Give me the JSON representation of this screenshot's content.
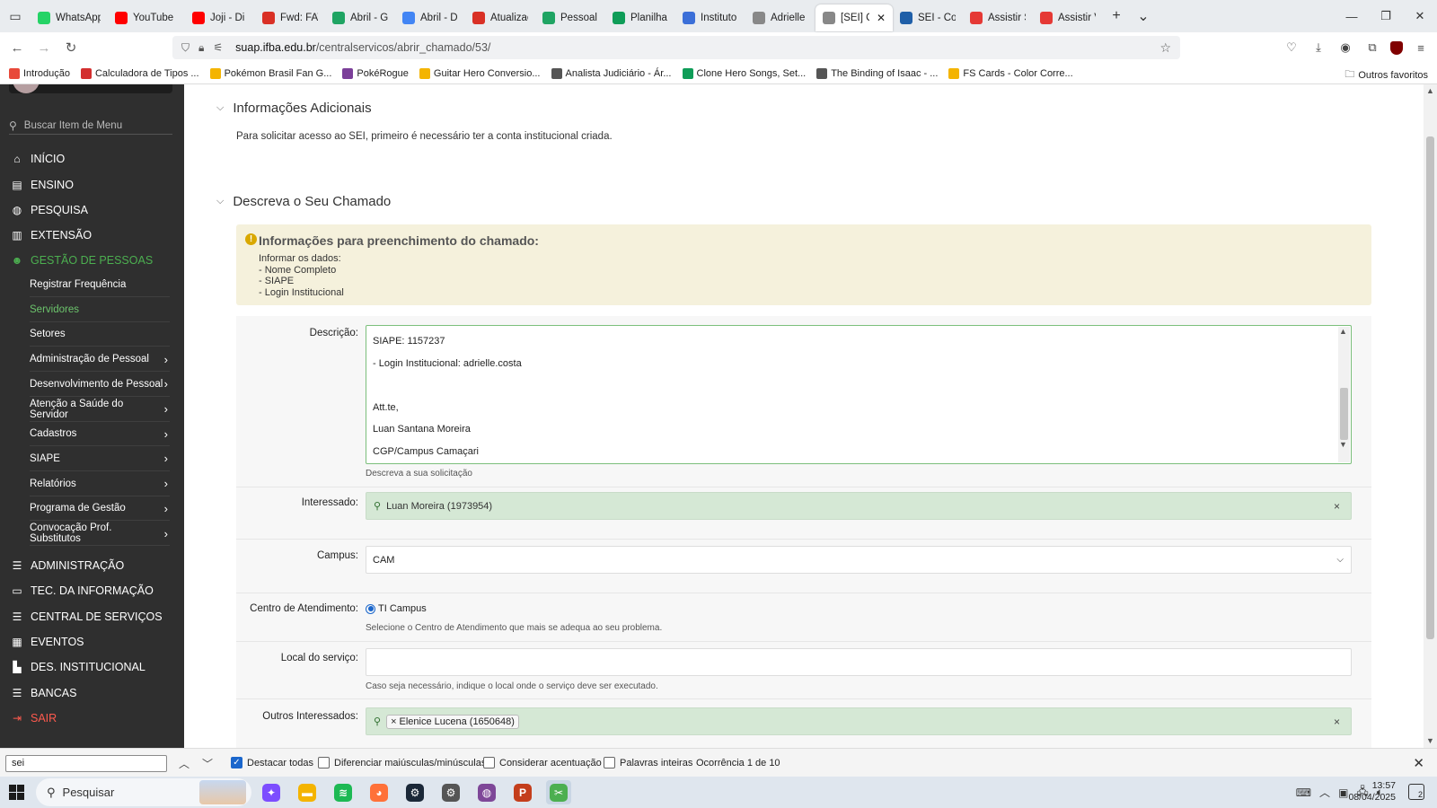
{
  "browser": {
    "tabs": [
      {
        "label": "WhatsApp",
        "icon": "whatsapp-icon",
        "color": "#25d366",
        "active": false
      },
      {
        "label": "YouTube",
        "icon": "youtube-icon",
        "color": "#ff0000",
        "active": false
      },
      {
        "label": "Joji - Di",
        "icon": "youtube-icon",
        "color": "#ff0000",
        "active": false
      },
      {
        "label": "Fwd: FATURA",
        "icon": "gmail-icon",
        "color": "#d93025",
        "active": false
      },
      {
        "label": "Abril - Goog",
        "icon": "drive-icon",
        "color": "#1fa463",
        "active": false
      },
      {
        "label": "Abril - Docu",
        "icon": "docs-icon",
        "color": "#4285f4",
        "active": false
      },
      {
        "label": "Atualização",
        "icon": "gmail-icon",
        "color": "#d93025",
        "active": false
      },
      {
        "label": "Pessoal - Go",
        "icon": "drive-icon",
        "color": "#1fa463",
        "active": false
      },
      {
        "label": "Planilha din",
        "icon": "sheets-icon",
        "color": "#0f9d58",
        "active": false
      },
      {
        "label": "Instituto Fed",
        "icon": "ifba-icon",
        "color": "#3b6fd8",
        "active": false
      },
      {
        "label": "Adrielle Cost",
        "icon": "suap-icon",
        "color": "#888888",
        "active": false
      },
      {
        "label": "[SEI] Criaç",
        "icon": "suap-icon",
        "color": "#888888",
        "active": true
      },
      {
        "label": "SEI - Contro",
        "icon": "sei-icon",
        "color": "#1f5fa8",
        "active": false
      },
      {
        "label": "Assistir Saik",
        "icon": "anime-icon",
        "color": "#e53935",
        "active": false
      },
      {
        "label": "Assistir Vigil",
        "icon": "anime-icon",
        "color": "#e53935",
        "active": false
      }
    ],
    "url_domain": "suap.ifba.edu.br",
    "url_path": "/centralservicos/abrir_chamado/53/",
    "bookmarks": [
      {
        "label": "Introdução",
        "color": "#e8493a"
      },
      {
        "label": "Calculadora de Tipos ...",
        "color": "#d32f2f"
      },
      {
        "label": "Pokémon Brasil Fan G...",
        "color": "#f4b400"
      },
      {
        "label": "PokéRogue",
        "color": "#7b3f99"
      },
      {
        "label": "Guitar Hero Conversio...",
        "color": "#f4b400"
      },
      {
        "label": "Analista Judiciário - Ár...",
        "color": "#555555"
      },
      {
        "label": "Clone Hero Songs, Set...",
        "color": "#0f9d58"
      },
      {
        "label": "The Binding of Isaac - ...",
        "color": "#555555"
      },
      {
        "label": "FS Cards - Color Corre...",
        "color": "#f4b400"
      }
    ],
    "bookmarks_other": "Outros favoritos"
  },
  "sidebar": {
    "search_placeholder": "Buscar Item de Menu",
    "main_items": [
      {
        "label": "INÍCIO",
        "icon": "home-icon",
        "glyph": "⌂"
      },
      {
        "label": "ENSINO",
        "icon": "ensino-icon",
        "glyph": "▤"
      },
      {
        "label": "PESQUISA",
        "icon": "globe-icon",
        "glyph": "◍"
      },
      {
        "label": "EXTENSÃO",
        "icon": "building-icon",
        "glyph": "▥"
      },
      {
        "label": "GESTÃO DE PESSOAS",
        "icon": "users-icon",
        "glyph": "☻"
      }
    ],
    "sub_items": [
      {
        "label": "Registrar Frequência",
        "chevron": false
      },
      {
        "label": "Servidores",
        "chevron": false
      },
      {
        "label": "Setores",
        "chevron": false
      },
      {
        "label": "Administração de Pessoal",
        "chevron": true
      },
      {
        "label": "Desenvolvimento de Pessoal",
        "chevron": true
      },
      {
        "label": "Atenção a Saúde do Servidor",
        "chevron": true
      },
      {
        "label": "Cadastros",
        "chevron": true
      },
      {
        "label": "SIAPE",
        "chevron": true
      },
      {
        "label": "Relatórios",
        "chevron": true
      },
      {
        "label": "Programa de Gestão",
        "chevron": true
      },
      {
        "label": "Convocação Prof. Substitutos",
        "chevron": true
      }
    ],
    "bottom_items": [
      {
        "label": "ADMINISTRAÇÃO",
        "icon": "list-icon",
        "glyph": "☰"
      },
      {
        "label": "TEC. DA INFORMAÇÃO",
        "icon": "laptop-icon",
        "glyph": "▭"
      },
      {
        "label": "CENTRAL DE SERVIÇOS",
        "icon": "list-icon",
        "glyph": "☰"
      },
      {
        "label": "EVENTOS",
        "icon": "calendar-icon",
        "glyph": "▦"
      },
      {
        "label": "DES. INSTITUCIONAL",
        "icon": "chart-icon",
        "glyph": "▙"
      },
      {
        "label": "BANCAS",
        "icon": "list-icon",
        "glyph": "☰"
      },
      {
        "label": "SAIR",
        "icon": "logout-icon",
        "glyph": "⇥"
      }
    ],
    "colors": {
      "active": "#4caf50",
      "logout": "#ff5a4e"
    }
  },
  "main": {
    "section_info_title": "Informações Adicionais",
    "section_info_text": "Para solicitar acesso ao SEI, primeiro é necessário ter a conta institucional criada.",
    "section_describe_title": "Descreva o Seu Chamado",
    "alert": {
      "title": "Informações para preenchimento do chamado:",
      "lines": [
        "Informar os dados:",
        "- Nome Completo",
        "- SIAPE",
        "- Login Institucional"
      ]
    },
    "form": {
      "descricao_label": "Descrição:",
      "descricao_lines": [
        "SIAPE: 1157237",
        "- Login Institucional: adrielle.costa",
        "",
        "Att.te,",
        "Luan Santana Moreira",
        "CGP/Campus Camaçari"
      ],
      "descricao_help": "Descreva a sua solicitação",
      "interessado_label": "Interessado:",
      "interessado_value": "Luan Moreira (1973954)",
      "campus_label": "Campus:",
      "campus_value": "CAM",
      "centro_label": "Centro de Atendimento:",
      "centro_option": "TI Campus",
      "centro_help": "Selecione o Centro de Atendimento que mais se adequa ao seu problema.",
      "local_label": "Local do serviço:",
      "local_value": "",
      "local_help": "Caso seja necessário, indique o local onde o serviço deve ser executado.",
      "outros_label": "Outros Interessados:",
      "outros_chip": "Elenice Lucena (1650648)",
      "remove_symbol": "×"
    }
  },
  "findbar": {
    "query": "sei",
    "options": [
      {
        "label": "Destacar todas",
        "checked": true
      },
      {
        "label": "Diferenciar maiúsculas/minúsculas",
        "checked": false
      },
      {
        "label": "Considerar acentuação",
        "checked": false
      },
      {
        "label": "Palavras inteiras",
        "checked": false
      }
    ],
    "count": "Ocorrência 1 de 10"
  },
  "taskbar": {
    "search_placeholder": "Pesquisar",
    "apps": [
      {
        "name": "copilot-icon",
        "color": "#7c4dff"
      },
      {
        "name": "file-explorer-icon",
        "color": "#f4b400"
      },
      {
        "name": "spotify-icon",
        "color": "#1db954"
      },
      {
        "name": "firefox-icon",
        "color": "#ff7139"
      },
      {
        "name": "steam-icon",
        "color": "#1b2838"
      },
      {
        "name": "settings-icon",
        "color": "#555555"
      },
      {
        "name": "tor-icon",
        "color": "#7e4798"
      },
      {
        "name": "powerpoint-icon",
        "color": "#c43e1c"
      },
      {
        "name": "snipping-tool-icon",
        "color": "#4caf50"
      }
    ],
    "time": "13:57",
    "date": "08/04/2025",
    "notifications": "2"
  }
}
